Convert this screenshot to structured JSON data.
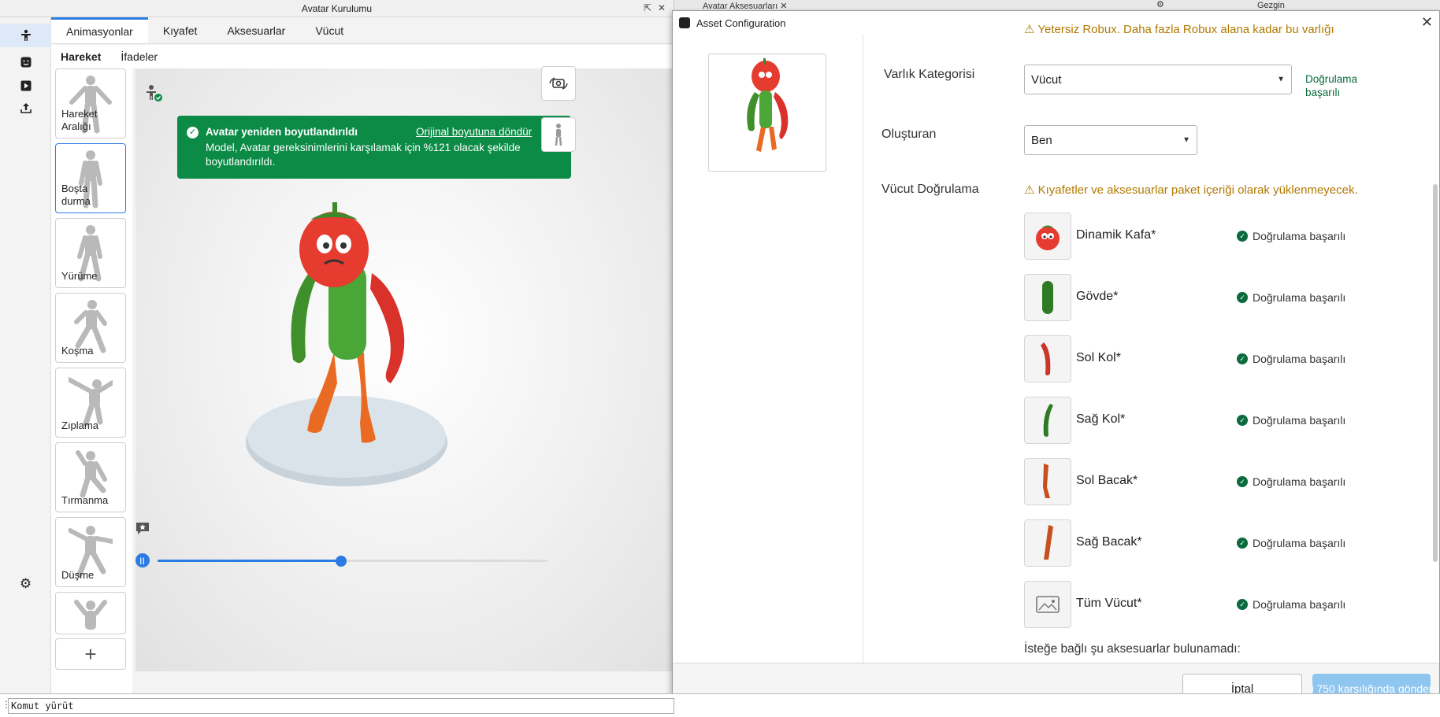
{
  "avatar_window": {
    "title": "Avatar Kurulumu",
    "tabs": [
      "Animasyonlar",
      "Kıyafet",
      "Aksesuarlar",
      "Vücut"
    ],
    "subtabs": [
      "Hareket",
      "İfadeler"
    ],
    "animations": [
      "Hareket Aralığı",
      "Boşta durma",
      "Yürüme",
      "Koşma",
      "Zıplama",
      "Tırmanma",
      "Düşme",
      ""
    ],
    "toast": {
      "title": "Avatar yeniden boyutlandırıldı",
      "link": "Orijinal boyutuna döndür",
      "message": "Model, Avatar gereksinimlerini karşılamak için %121 olacak şekilde boyutlandırıldı."
    },
    "timeline_progress": 0.47,
    "accent_color": "#2b7be4",
    "toast_color": "#0c8b47"
  },
  "background_tabs": [
    "Avatar Aksesuarları",
    "Gezgin"
  ],
  "dialog": {
    "title": "Asset Configuration",
    "top_warning": "Yetersiz Robux. Daha fazla Robux alana kadar bu varlığı",
    "asset_category_label": "Varlık Kategorisi",
    "asset_category_value": "Vücut",
    "asset_category_status": "Doğrulama başarılı",
    "creator_label": "Oluşturan",
    "creator_value": "Ben",
    "body_validation_label": "Vücut Doğrulama",
    "body_validation_warning": "Kıyafetler ve aksesuarlar paket içeriği olarak yüklenmeyecek.",
    "parts": [
      {
        "name": "Dinamik Kafa*",
        "status": "Doğrulama başarılı"
      },
      {
        "name": "Gövde*",
        "status": "Doğrulama başarılı"
      },
      {
        "name": "Sol Kol*",
        "status": "Doğrulama başarılı"
      },
      {
        "name": "Sağ Kol*",
        "status": "Doğrulama başarılı"
      },
      {
        "name": "Sol Bacak*",
        "status": "Doğrulama başarılı"
      },
      {
        "name": "Sağ Bacak*",
        "status": "Doğrulama başarılı"
      },
      {
        "name": "Tüm Vücut*",
        "status": "Doğrulama başarılı"
      }
    ],
    "optional_text": "İsteğe bağlı şu aksesuarlar bulunamadı:",
    "cancel_label": "İptal",
    "submit_label": "750 karşılığında gönder",
    "warning_color": "#b17a00",
    "success_color": "#0c6b3e"
  },
  "command_bar": {
    "placeholder": "Komut yürüt"
  }
}
